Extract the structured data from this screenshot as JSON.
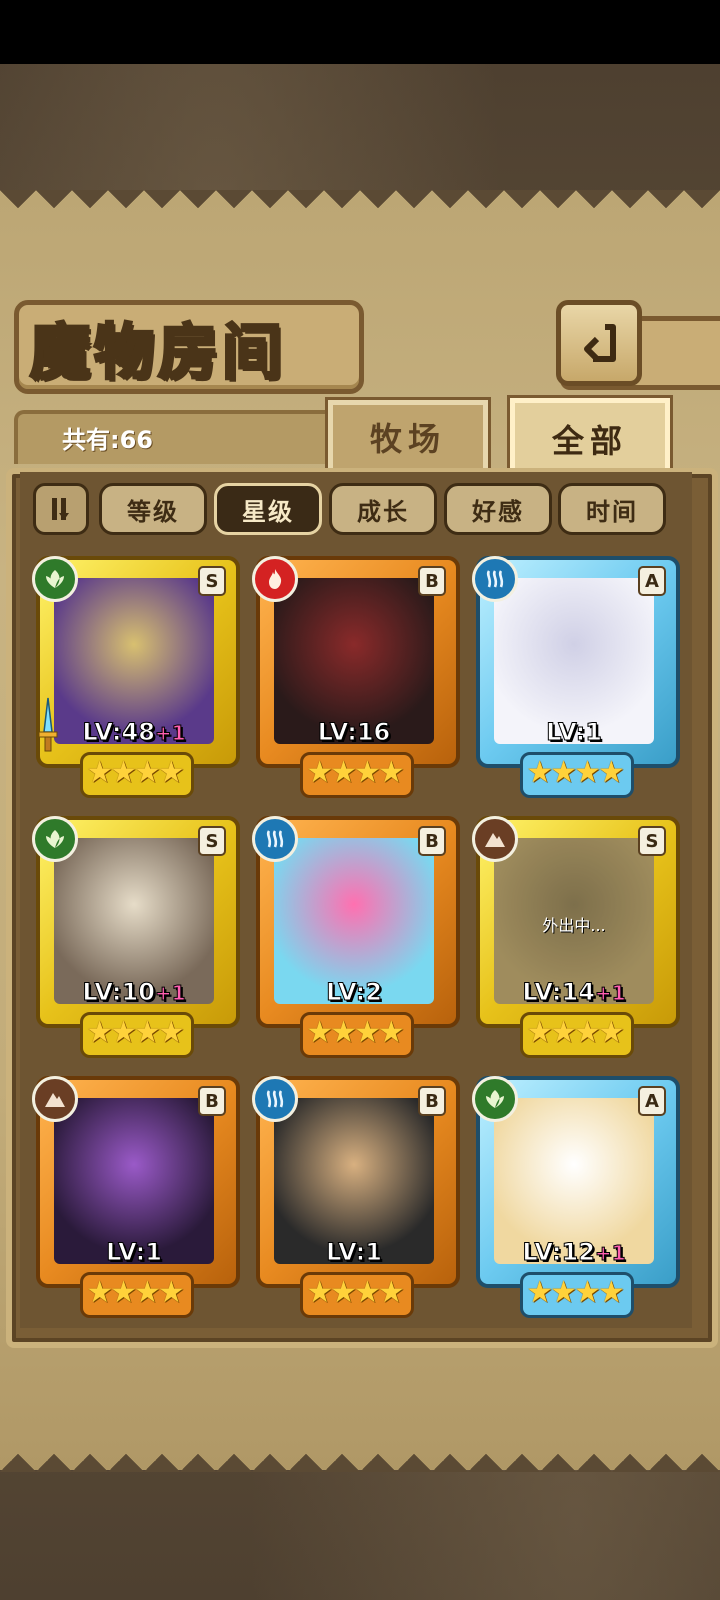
{
  "screen": {
    "title": "魔物房间",
    "total_label": "共有:66"
  },
  "tabs": [
    {
      "label": "牧场",
      "selected": false
    },
    {
      "label": "全部",
      "selected": true
    }
  ],
  "sort": {
    "toggle_icon": "sort-order-icon",
    "options": [
      {
        "label": "等级",
        "active": false
      },
      {
        "label": "星级",
        "active": true
      },
      {
        "label": "成长",
        "active": false
      },
      {
        "label": "好感",
        "active": false
      },
      {
        "label": "时间",
        "active": false
      }
    ]
  },
  "monsters": [
    {
      "element": "nature",
      "rank": "S",
      "frame": "gold",
      "level": "LV:48",
      "plus": "+1",
      "stars": 4,
      "status": "",
      "equip": "sword-icon",
      "art": [
        "#5a3a8a",
        "#d8c070"
      ]
    },
    {
      "element": "fire",
      "rank": "B",
      "frame": "orange",
      "level": "LV:16",
      "plus": "",
      "stars": 4,
      "status": "",
      "art": [
        "#2a1a1a",
        "#8a2a2a"
      ]
    },
    {
      "element": "water",
      "rank": "A",
      "frame": "blue",
      "level": "LV:1",
      "plus": "",
      "stars": 4,
      "status": "",
      "art": [
        "#f4f4fa",
        "#d0d0e6"
      ]
    },
    {
      "element": "nature",
      "rank": "S",
      "frame": "gold",
      "level": "LV:10",
      "plus": "+1",
      "stars": 4,
      "status": "",
      "art": [
        "#7a6a5a",
        "#e6dcc8"
      ]
    },
    {
      "element": "water",
      "rank": "B",
      "frame": "orange",
      "level": "LV:2",
      "plus": "",
      "stars": 4,
      "status": "",
      "art": [
        "#7ad8f0",
        "#ff70b0"
      ]
    },
    {
      "element": "earth",
      "rank": "S",
      "frame": "gold",
      "level": "LV:14",
      "plus": "+1",
      "stars": 4,
      "status": "外出中...",
      "art": [
        "#b09a58",
        "#8a7a48"
      ]
    },
    {
      "element": "earth",
      "rank": "B",
      "frame": "orange",
      "level": "LV:1",
      "plus": "",
      "stars": 4,
      "status": "",
      "art": [
        "#2a1a3a",
        "#9a5ac8"
      ]
    },
    {
      "element": "water",
      "rank": "B",
      "frame": "orange",
      "level": "LV:1",
      "plus": "",
      "stars": 4,
      "status": "",
      "art": [
        "#2a2a2a",
        "#d8b080"
      ]
    },
    {
      "element": "nature",
      "rank": "A",
      "frame": "blue",
      "level": "LV:12",
      "plus": "+1",
      "stars": 4,
      "status": "",
      "art": [
        "#f0d8a0",
        "#ffffff"
      ]
    }
  ],
  "icons": {
    "back": "back-arrow-icon",
    "elements": {
      "nature": "leaf-icon",
      "fire": "flame-icon",
      "water": "wave-icon",
      "earth": "mountain-icon"
    }
  }
}
